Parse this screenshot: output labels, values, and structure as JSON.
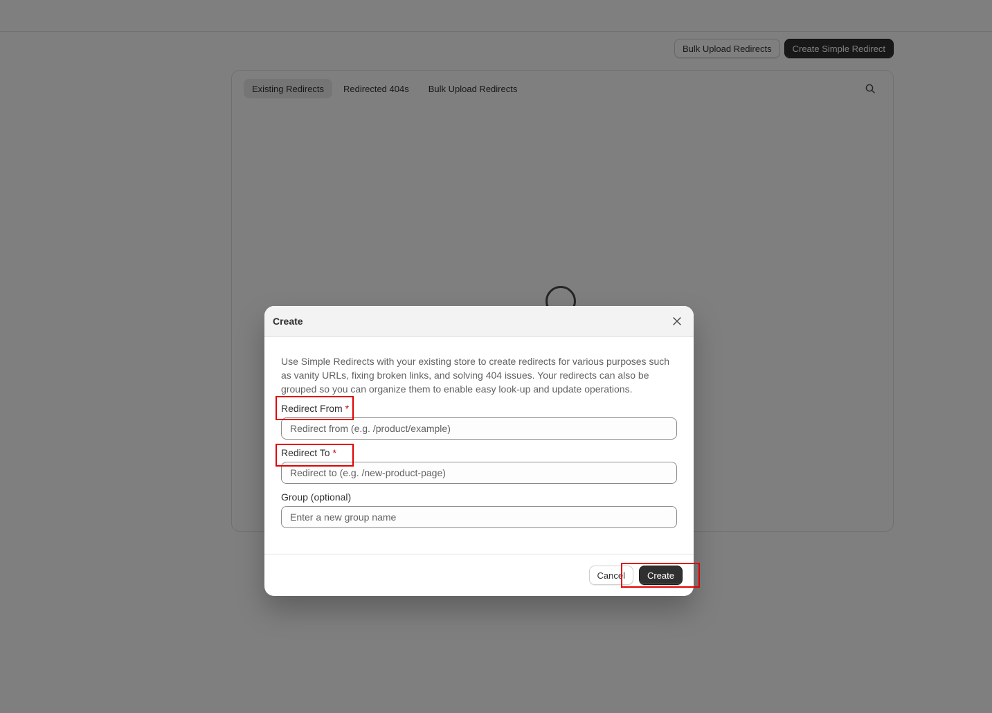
{
  "header": {
    "bulk_upload_label": "Bulk Upload Redirects",
    "create_simple_label": "Create Simple Redirect"
  },
  "tabs": [
    {
      "label": "Existing Redirects",
      "active": true
    },
    {
      "label": "Redirected 404s",
      "active": false
    },
    {
      "label": "Bulk Upload Redirects",
      "active": false
    }
  ],
  "icons": {
    "search": "search-icon",
    "close": "close-icon",
    "loading": "spinner-icon"
  },
  "modal": {
    "title": "Create",
    "description": "Use Simple Redirects with your existing store to create redirects for various purposes such as vanity URLs, fixing broken links, and solving 404 issues. Your redirects can also be grouped so you can organize them to enable easy look-up and update operations.",
    "fields": {
      "from": {
        "label": "Redirect From",
        "required_mark": "*",
        "placeholder": "Redirect from (e.g. /product/example)",
        "value": ""
      },
      "to": {
        "label": "Redirect To",
        "required_mark": "*",
        "placeholder": "Redirect to (e.g. /new-product-page)",
        "value": ""
      },
      "group": {
        "label": "Group (optional)",
        "placeholder": "Enter a new group name",
        "value": ""
      }
    },
    "cancel_label": "Cancel",
    "create_label": "Create"
  },
  "colors": {
    "primary_button": "#303030",
    "highlight": "#e00000",
    "required_mark": "#c00000",
    "backdrop": "rgba(0,0,0,0.5)"
  }
}
